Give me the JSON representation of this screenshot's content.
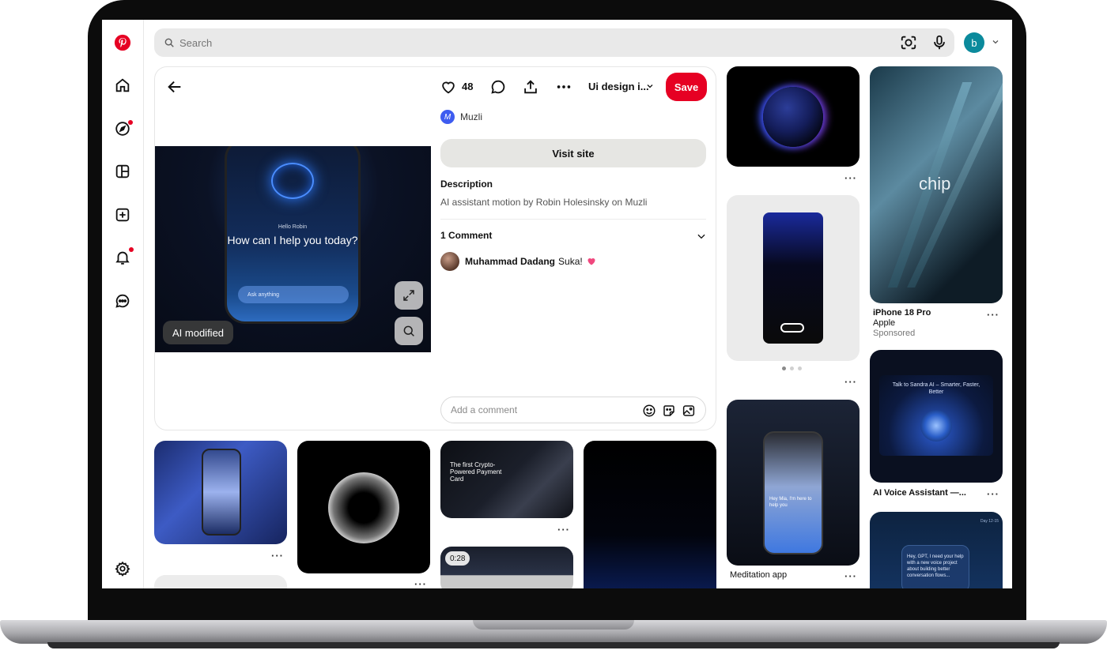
{
  "search": {
    "placeholder": "Search"
  },
  "account": {
    "initial": "b"
  },
  "pin": {
    "likes": "48",
    "board": "Ui design i...",
    "save_label": "Save",
    "author": "Muzli",
    "author_initial": "M",
    "visit_label": "Visit site",
    "description_heading": "Description",
    "description": "AI assistant motion by Robin Holesinsky on Muzli",
    "comments_heading": "1 Comment",
    "comment_author": "Muhammad Dadang",
    "comment_text": "Suka!",
    "comment_placeholder": "Add a comment",
    "ai_badge": "AI modified",
    "image": {
      "hello": "Hello Robin",
      "title": "How can I help you today?",
      "ask": "Ask anything"
    }
  },
  "tiles": {
    "chip": {
      "overlay": "chip",
      "title": "iPhone 18 Pro",
      "advertiser": "Apple",
      "label": "Sponsored"
    },
    "voice": {
      "title": "AI Voice Assistant —...",
      "headline": "Talk to Sandra AI – Smarter, Faster, Better"
    },
    "meditation": {
      "title": "Meditation app",
      "greeting": "Hey Mia, I'm here to help you"
    },
    "card": {
      "headline": "The first Crypto-Powered Payment Card"
    },
    "video": {
      "duration": "0:28"
    },
    "gpt": {
      "date": "Day 12-15",
      "message": "Hey, GPT, I need your help with a new voice project about building better conversation flows..."
    }
  },
  "more_label": "···"
}
